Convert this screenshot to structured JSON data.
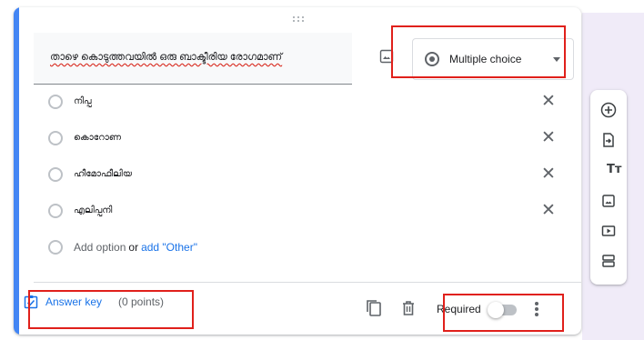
{
  "question": {
    "title": "താഴെ കൊടുത്തവയിൽ ഒരു ബാക്ടീരിയ രോഗമാണ്",
    "type": "Multiple choice"
  },
  "options": [
    {
      "label": "നിപ്പ"
    },
    {
      "label": "കൊറോണ"
    },
    {
      "label": "ഹീമോഫീലിയ"
    },
    {
      "label": "എലിപ്പനി"
    }
  ],
  "add_option": {
    "label": "Add option",
    "or": "or",
    "other": "add \"Other\""
  },
  "footer": {
    "answer_key": "Answer key",
    "points": "(0 points)",
    "required": "Required",
    "required_on": false
  },
  "toolbar": {
    "text_glyph": "Tт"
  },
  "colors": {
    "accent": "#4285f4",
    "highlight_box": "#e0201b",
    "link": "#1a73e8"
  },
  "icons": [
    "drag-handle-icon",
    "image-icon",
    "close-icon",
    "answer-key-icon",
    "duplicate-icon",
    "delete-icon",
    "more-vert-icon",
    "add-question-icon",
    "import-icon",
    "title-icon",
    "image-icon",
    "video-icon",
    "section-icon"
  ]
}
